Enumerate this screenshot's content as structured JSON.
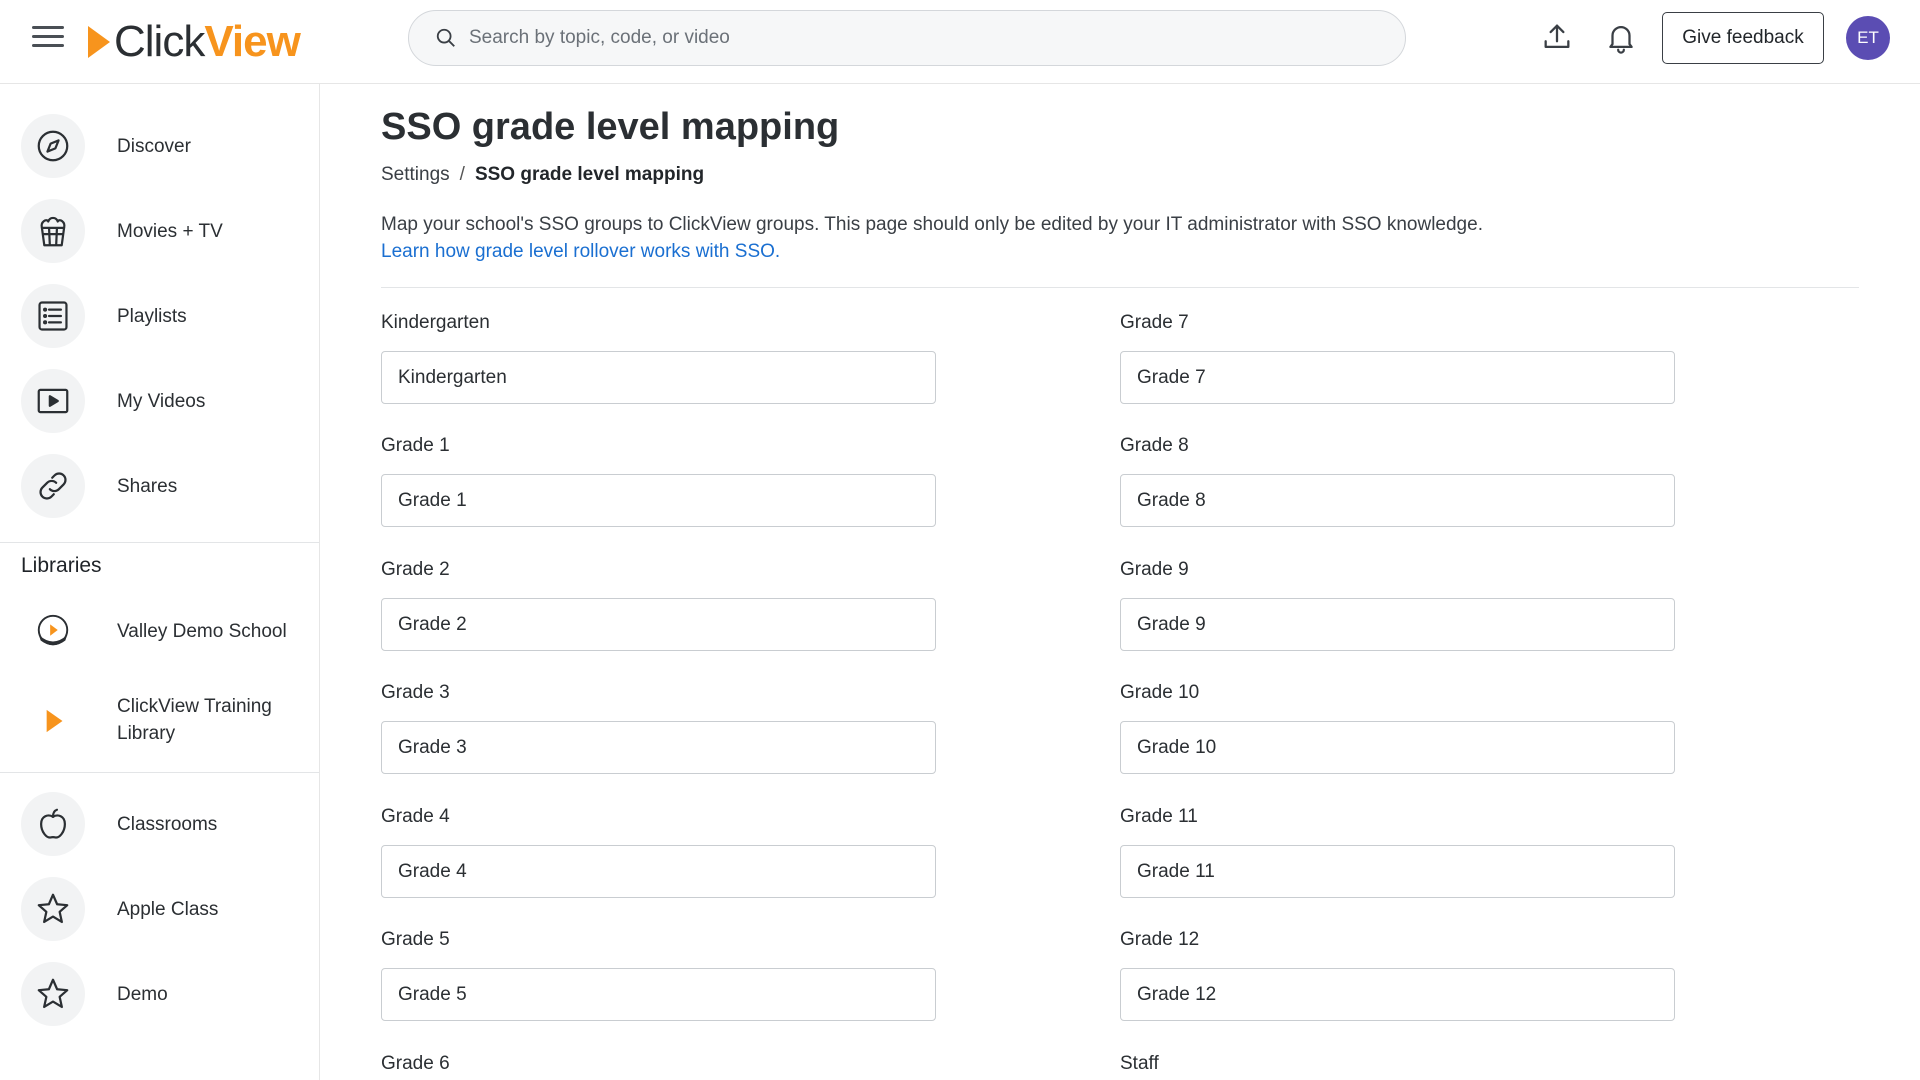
{
  "header": {
    "logo_click": "Click",
    "logo_view": "View",
    "search_placeholder": "Search by topic, code, or video",
    "feedback_label": "Give feedback",
    "avatar_initials": "ET"
  },
  "sidebar": {
    "items": [
      {
        "label": "Discover",
        "icon": "compass-icon"
      },
      {
        "label": "Movies + TV",
        "icon": "popcorn-icon"
      },
      {
        "label": "Playlists",
        "icon": "list-icon"
      },
      {
        "label": "My Videos",
        "icon": "play-box-icon"
      },
      {
        "label": "Shares",
        "icon": "link-icon"
      }
    ],
    "libraries_title": "Libraries",
    "libraries": [
      {
        "label": "Valley Demo School",
        "icon": "school-badge-icon"
      },
      {
        "label_line1": "ClickView Training",
        "label_line2": "Library",
        "icon": "clickview-play-icon"
      }
    ],
    "classes": [
      {
        "label": "Classrooms",
        "icon": "apple-icon"
      },
      {
        "label": "Apple Class",
        "icon": "star-icon"
      },
      {
        "label": "Demo",
        "icon": "star-icon"
      }
    ]
  },
  "main": {
    "title": "SSO grade level mapping",
    "breadcrumb": {
      "parent": "Settings",
      "separator": "/",
      "current": "SSO grade level mapping"
    },
    "description": "Map your school's SSO groups to ClickView groups. This page should only be edited by your IT administrator with SSO knowledge.",
    "help_link": "Learn how grade level rollover works with SSO.",
    "fields_left": [
      {
        "label": "Kindergarten",
        "value": "Kindergarten"
      },
      {
        "label": "Grade 1",
        "value": "Grade 1"
      },
      {
        "label": "Grade 2",
        "value": "Grade 2"
      },
      {
        "label": "Grade 3",
        "value": "Grade 3"
      },
      {
        "label": "Grade 4",
        "value": "Grade 4"
      },
      {
        "label": "Grade 5",
        "value": "Grade 5"
      },
      {
        "label": "Grade 6",
        "value": ""
      }
    ],
    "fields_right": [
      {
        "label": "Grade 7",
        "value": "Grade 7"
      },
      {
        "label": "Grade 8",
        "value": "Grade 8"
      },
      {
        "label": "Grade 9",
        "value": "Grade 9"
      },
      {
        "label": "Grade 10",
        "value": "Grade 10"
      },
      {
        "label": "Grade 11",
        "value": "Grade 11"
      },
      {
        "label": "Grade 12",
        "value": "Grade 12"
      },
      {
        "label": "Staff",
        "value": ""
      }
    ]
  },
  "colors": {
    "brand_orange": "#f7941d",
    "link_blue": "#1a6fd1",
    "avatar_purple": "#5b4db3"
  }
}
